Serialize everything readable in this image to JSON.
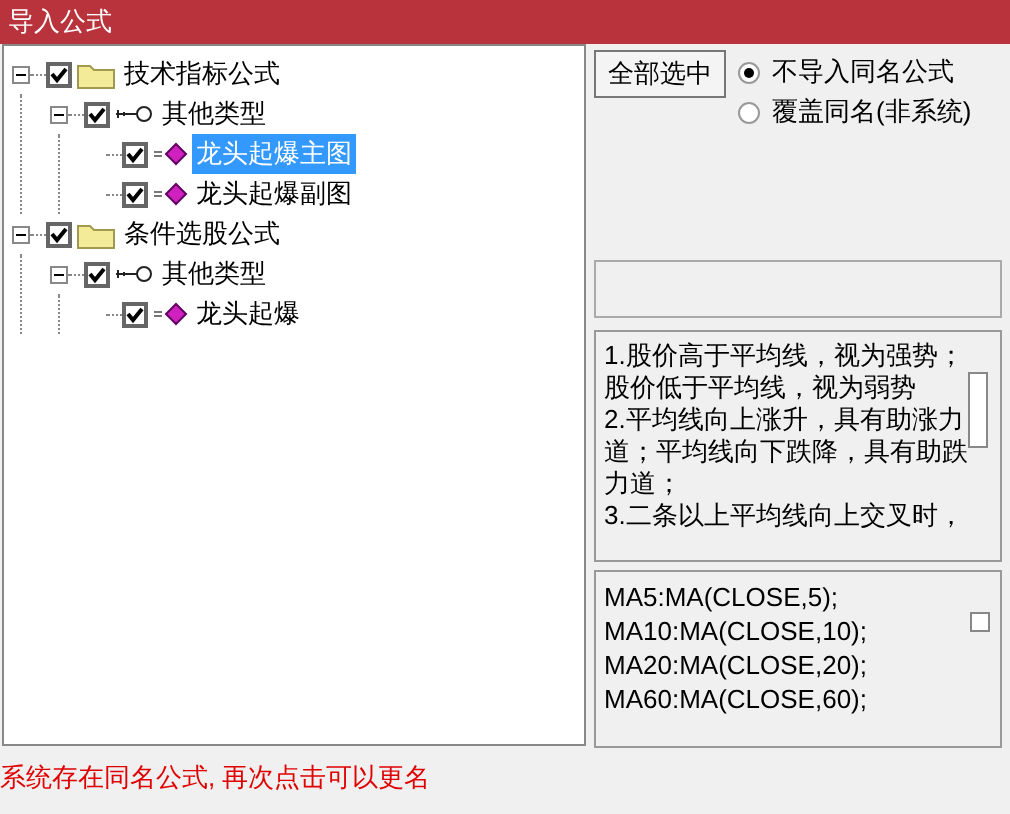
{
  "window": {
    "title": "导入公式"
  },
  "tree": [
    {
      "label": "技术指标公式",
      "kind": "folder",
      "checked": true,
      "expanded": true,
      "selected": false,
      "children": [
        {
          "label": "其他类型",
          "kind": "type",
          "checked": true,
          "expanded": true,
          "selected": false,
          "children": [
            {
              "label": "龙头起爆主图",
              "kind": "formula",
              "checked": true,
              "selected": true
            },
            {
              "label": "龙头起爆副图",
              "kind": "formula",
              "checked": true,
              "selected": false
            }
          ]
        }
      ]
    },
    {
      "label": "条件选股公式",
      "kind": "folder",
      "checked": true,
      "expanded": true,
      "selected": false,
      "children": [
        {
          "label": "其他类型",
          "kind": "type",
          "checked": true,
          "expanded": true,
          "selected": false,
          "children": [
            {
              "label": "龙头起爆",
              "kind": "formula",
              "checked": true,
              "selected": false
            }
          ]
        }
      ]
    }
  ],
  "select_all_button": "全部选中",
  "options": [
    {
      "label": "不导入同名公式",
      "selected": true
    },
    {
      "label": "覆盖同名(非系统)",
      "selected": false
    }
  ],
  "description": [
    "1.股价高于平均线，视为强势；",
    "股价低于平均线，视为弱势",
    "2.平均线向上涨升，具有助涨力",
    "道；平均线向下跌降，具有助跌",
    "力道；",
    "3.二条以上平均线向上交叉时，"
  ],
  "code": [
    "MA5:MA(CLOSE,5);",
    "MA10:MA(CLOSE,10);",
    "MA20:MA(CLOSE,20);",
    "MA60:MA(CLOSE,60);"
  ],
  "status": "系统存在同名公式, 再次点击可以更名"
}
